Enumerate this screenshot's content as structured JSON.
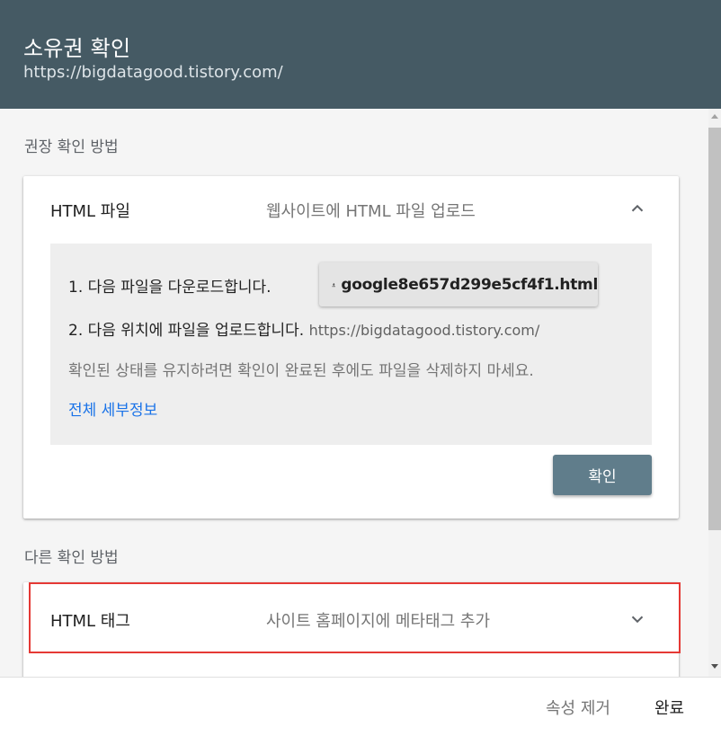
{
  "header": {
    "title": "소유권 확인",
    "url": "https://bigdatagood.tistory.com/"
  },
  "recommended": {
    "section_label": "권장 확인 방법",
    "method_name": "HTML 파일",
    "method_desc": "웹사이트에 HTML 파일 업로드",
    "chevron_icon": "chevron-up-icon",
    "step1": "1. 다음 파일을 다운로드합니다.",
    "download_icon": "download-icon",
    "download_filename": "google8e657d299e5cf4f1.html",
    "step2": "2. 다음 위치에 파일을 업로드합니다.",
    "step2_url": "https://bigdatagood.tistory.com/",
    "note": "확인된 상태를 유지하려면 확인이 완료된 후에도 파일을 삭제하지 마세요.",
    "details_link": "전체 세부정보",
    "verify_button": "확인"
  },
  "other": {
    "section_label": "다른 확인 방법",
    "method_name": "HTML 태그",
    "method_desc": "사이트 홈페이지에 메타태그 추가",
    "chevron_icon": "chevron-down-icon",
    "highlight_color": "#e53935"
  },
  "footer": {
    "remove_property": "속성 제거",
    "done": "완료"
  },
  "colors": {
    "header_bg": "#455a64",
    "verify_button_bg": "#607d8b",
    "link": "#1a73e8"
  }
}
